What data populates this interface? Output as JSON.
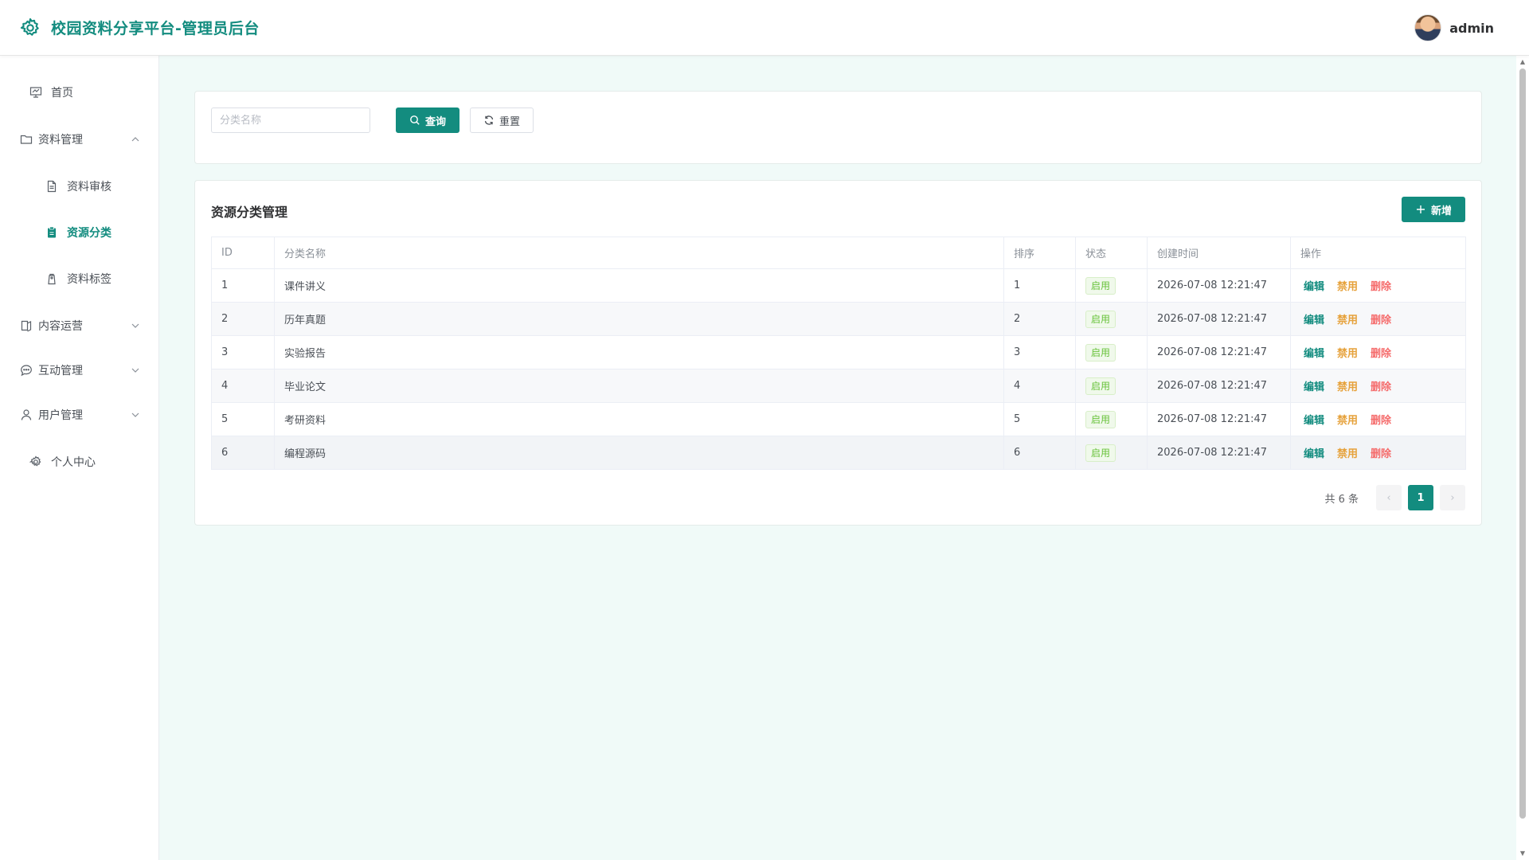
{
  "header": {
    "title": "校园资料分享平台-管理员后台",
    "username": "admin"
  },
  "sidebar": {
    "home": "首页",
    "materials": "资料管理",
    "review": "资料审核",
    "category": "资源分类",
    "tags": "资料标签",
    "content_ops": "内容运营",
    "interaction": "互动管理",
    "users": "用户管理",
    "profile": "个人中心"
  },
  "search": {
    "placeholder": "分类名称",
    "query_label": "查询",
    "reset_label": "重置"
  },
  "table_card": {
    "title": "资源分类管理",
    "add_label": "新增",
    "columns": [
      "ID",
      "分类名称",
      "排序",
      "状态",
      "创建时间",
      "操作"
    ],
    "rows": [
      {
        "id": "1",
        "name": "课件讲义",
        "sort": "1",
        "status": "启用",
        "created": "2026-07-08 12:21:47"
      },
      {
        "id": "2",
        "name": "历年真题",
        "sort": "2",
        "status": "启用",
        "created": "2026-07-08 12:21:47"
      },
      {
        "id": "3",
        "name": "实验报告",
        "sort": "3",
        "status": "启用",
        "created": "2026-07-08 12:21:47"
      },
      {
        "id": "4",
        "name": "毕业论文",
        "sort": "4",
        "status": "启用",
        "created": "2026-07-08 12:21:47"
      },
      {
        "id": "5",
        "name": "考研资料",
        "sort": "5",
        "status": "启用",
        "created": "2026-07-08 12:21:47"
      },
      {
        "id": "6",
        "name": "编程源码",
        "sort": "6",
        "status": "启用",
        "created": "2026-07-08 12:21:47"
      }
    ],
    "actions": {
      "edit": "编辑",
      "disable": "禁用",
      "delete": "删除"
    }
  },
  "pagination": {
    "total_text": "共 6 条",
    "current_page": "1",
    "prev": "‹",
    "next": "›"
  },
  "colors": {
    "primary": "#138c7f",
    "warning": "#e6a23c",
    "danger": "#f56c6c",
    "success": "#67c23a",
    "background": "#f0faf8"
  }
}
